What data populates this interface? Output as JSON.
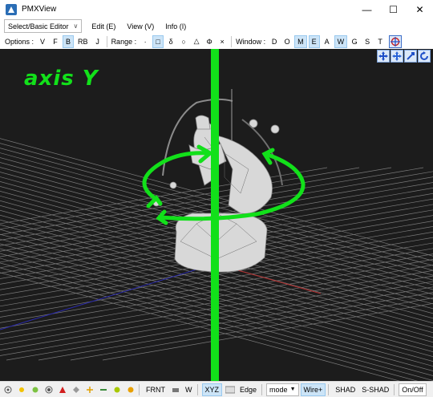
{
  "window": {
    "title": "PMXView"
  },
  "menubar": {
    "editor_select": "Select/Basic Editor",
    "items": [
      "Edit (E)",
      "View (V)",
      "Info (I)"
    ]
  },
  "toolbar": {
    "options_label": "Options :",
    "options": [
      {
        "label": "V",
        "selected": false
      },
      {
        "label": "F",
        "selected": false
      },
      {
        "label": "B",
        "selected": true
      },
      {
        "label": "RB",
        "selected": false
      },
      {
        "label": "J",
        "selected": false
      }
    ],
    "range_label": "Range :",
    "range": [
      {
        "label": "·",
        "selected": false
      },
      {
        "label": "□",
        "selected": true
      },
      {
        "label": "δ",
        "selected": false
      },
      {
        "label": "○",
        "selected": false
      },
      {
        "label": "△",
        "selected": false
      },
      {
        "label": "Φ",
        "selected": false
      },
      {
        "label": "×",
        "selected": false
      }
    ],
    "window_label": "Window :",
    "window": [
      {
        "label": "D",
        "selected": false
      },
      {
        "label": "O",
        "selected": false
      },
      {
        "label": "M",
        "selected": true
      },
      {
        "label": "E",
        "selected": true
      },
      {
        "label": "A",
        "selected": false
      },
      {
        "label": "W",
        "selected": true
      },
      {
        "label": "G",
        "selected": false
      },
      {
        "label": "S",
        "selected": false
      },
      {
        "label": "T",
        "selected": false
      }
    ]
  },
  "annotation": {
    "text": "axis Y"
  },
  "statusbar": {
    "view": "FRNT",
    "w": "W",
    "xyz": "XYZ",
    "edge": "Edge",
    "mode": "mode",
    "wire": "Wire+",
    "shad": "SHAD",
    "sshad": "S-SHAD",
    "onoff": "On/Off"
  },
  "colors": {
    "annotation": "#12e01a",
    "viewport_bg": "#1c1c1c",
    "grid": "#7a7a7a",
    "selected": "#cce4f7"
  }
}
